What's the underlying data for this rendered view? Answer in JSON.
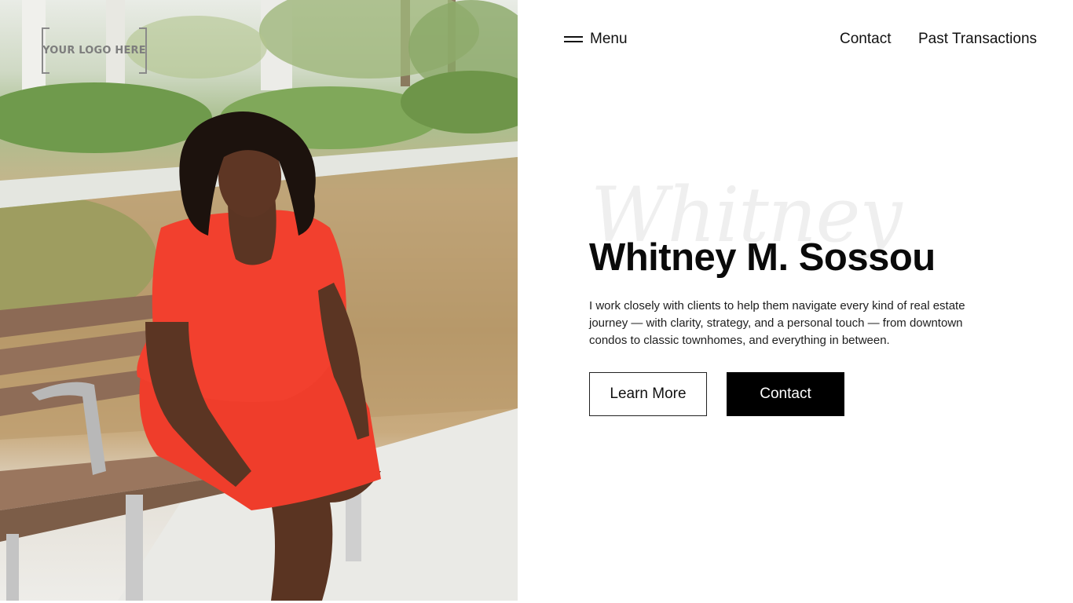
{
  "logo": {
    "text": "YOUR LOGO HERE"
  },
  "header": {
    "menu_label": "Menu",
    "links": [
      "Contact",
      "Past Transactions"
    ]
  },
  "hero": {
    "script_text": "Whitney",
    "title": "Whitney M. Sossou",
    "description": "I work closely with clients to help them navigate every kind of real estate journey — with clarity, strategy, and a personal touch — from downtown condos to classic townhomes, and everything in between.",
    "buttons": {
      "learn_more": "Learn More",
      "contact": "Contact"
    }
  },
  "colors": {
    "dress": "#f2402e",
    "primary_button": "#000000",
    "text": "#111111",
    "script_watermark": "#efefef"
  },
  "icons": [
    "hamburger-icon"
  ]
}
